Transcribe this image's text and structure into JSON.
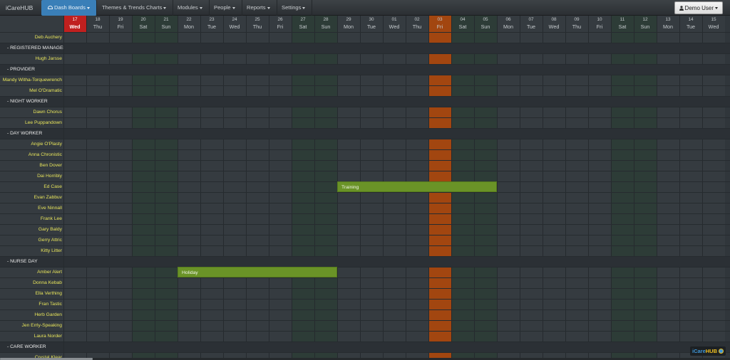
{
  "app": {
    "brand": "iCareHUB"
  },
  "nav": {
    "items": [
      {
        "label": "Dash Boards",
        "active": true,
        "icon": "dashboard-icon"
      },
      {
        "label": "Themes & Trends Charts",
        "active": false
      },
      {
        "label": "Modules",
        "active": false
      },
      {
        "label": "People",
        "active": false
      },
      {
        "label": "Reports",
        "active": false
      },
      {
        "label": "Settings",
        "active": false
      }
    ],
    "user": {
      "label": "Demo User",
      "icon": "user-icon"
    }
  },
  "calendar": {
    "days": [
      {
        "num": "17",
        "label": "Wed",
        "type": "today"
      },
      {
        "num": "18",
        "label": "Thu",
        "type": "weekday"
      },
      {
        "num": "19",
        "label": "Fri",
        "type": "weekday"
      },
      {
        "num": "20",
        "label": "Sat",
        "type": "weekend"
      },
      {
        "num": "21",
        "label": "Sun",
        "type": "weekend"
      },
      {
        "num": "22",
        "label": "Mon",
        "type": "weekday"
      },
      {
        "num": "23",
        "label": "Tue",
        "type": "weekday"
      },
      {
        "num": "24",
        "label": "Wed",
        "type": "weekday"
      },
      {
        "num": "25",
        "label": "Thu",
        "type": "weekday"
      },
      {
        "num": "26",
        "label": "Fri",
        "type": "weekday"
      },
      {
        "num": "27",
        "label": "Sat",
        "type": "weekend"
      },
      {
        "num": "28",
        "label": "Sun",
        "type": "weekend"
      },
      {
        "num": "29",
        "label": "Mon",
        "type": "weekday"
      },
      {
        "num": "30",
        "label": "Tue",
        "type": "weekday"
      },
      {
        "num": "01",
        "label": "Wed",
        "type": "weekday"
      },
      {
        "num": "02",
        "label": "Thu",
        "type": "weekday"
      },
      {
        "num": "03",
        "label": "Fri",
        "type": "highlight"
      },
      {
        "num": "04",
        "label": "Sat",
        "type": "weekend"
      },
      {
        "num": "05",
        "label": "Sun",
        "type": "weekend"
      },
      {
        "num": "06",
        "label": "Mon",
        "type": "weekday"
      },
      {
        "num": "07",
        "label": "Tue",
        "type": "weekday"
      },
      {
        "num": "08",
        "label": "Wed",
        "type": "weekday"
      },
      {
        "num": "09",
        "label": "Thu",
        "type": "weekday"
      },
      {
        "num": "10",
        "label": "Fri",
        "type": "weekday"
      },
      {
        "num": "11",
        "label": "Sat",
        "type": "weekend"
      },
      {
        "num": "12",
        "label": "Sun",
        "type": "weekend"
      },
      {
        "num": "13",
        "label": "Mon",
        "type": "weekday"
      },
      {
        "num": "14",
        "label": "Tue",
        "type": "weekday"
      },
      {
        "num": "15",
        "label": "Wed",
        "type": "weekday"
      }
    ],
    "rows": [
      {
        "name": "Deb Auchery",
        "group": false
      },
      {
        "name": "- REGISTERED MANAGER",
        "group": true
      },
      {
        "name": "Hugh Jarsse",
        "group": false
      },
      {
        "name": "- PROVIDER",
        "group": true
      },
      {
        "name": "Mandy Witha-Torquewrench",
        "group": false
      },
      {
        "name": "Mel O'Dramatic",
        "group": false
      },
      {
        "name": "- NIGHT WORKER",
        "group": true
      },
      {
        "name": "Dawn Chorus",
        "group": false
      },
      {
        "name": "Lee Puppandown",
        "group": false
      },
      {
        "name": "- DAY WORKER",
        "group": true
      },
      {
        "name": "Angie O'Plasty",
        "group": false
      },
      {
        "name": "Anna Chronistic",
        "group": false
      },
      {
        "name": "Ben Dover",
        "group": false
      },
      {
        "name": "Dai Horribly",
        "group": false
      },
      {
        "name": "Ed Case",
        "group": false
      },
      {
        "name": "Evan Zabbuv",
        "group": false
      },
      {
        "name": "Eve Ninnall",
        "group": false
      },
      {
        "name": "Frank Lee",
        "group": false
      },
      {
        "name": "Gary Baldy",
        "group": false
      },
      {
        "name": "Gerry Attric",
        "group": false
      },
      {
        "name": "Kitty Litter",
        "group": false
      },
      {
        "name": "- NURSE DAY",
        "group": true
      },
      {
        "name": "Amber Alert",
        "group": false
      },
      {
        "name": "Donna Kebab",
        "group": false
      },
      {
        "name": "Ella Verthing",
        "group": false
      },
      {
        "name": "Fran Tastic",
        "group": false
      },
      {
        "name": "Herb Garden",
        "group": false
      },
      {
        "name": "Jen Errly-Speaking",
        "group": false
      },
      {
        "name": "Laura Norder",
        "group": false
      },
      {
        "name": "- CARE WORKER",
        "group": true
      },
      {
        "name": "Crystal Klear",
        "group": false
      }
    ],
    "events": [
      {
        "label": "Training",
        "row": 14,
        "start": 12,
        "end": 19,
        "color": "#6a9327"
      },
      {
        "label": "Holiday",
        "row": 22,
        "start": 5,
        "end": 12,
        "color": "#6a9327"
      }
    ]
  },
  "footer": {
    "logo_a": "iCare",
    "logo_b": "HUB"
  },
  "colors": {
    "today": "#c0201f",
    "highlight": "#a24610",
    "weekend": "#2d3c37",
    "event": "#6a9327"
  }
}
